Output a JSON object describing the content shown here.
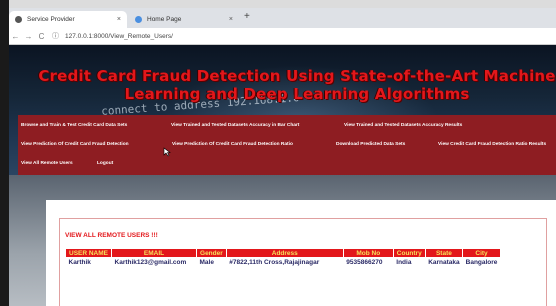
{
  "browser": {
    "tabs": [
      {
        "label": "Service Provider",
        "close": "×"
      },
      {
        "label": "Home Page",
        "close": "×"
      }
    ],
    "new_tab": "+",
    "nav": {
      "back": "←",
      "forward": "→",
      "reload": "C"
    },
    "url": "127.0.0.1:8000/View_Remote_Users/"
  },
  "hero": {
    "title": "Credit Card Fraud Detection Using State-of-the-Art Machine Learning and Deep Learning Algorithms",
    "code_text": "connect to address 192.168.1.0"
  },
  "menu": [
    "Browse and Train & Test Credit Card Data Sets",
    "View Trained and Tested Datasets Accuracy in Bar Chart",
    "View Trained and Tested Datasets Accuracy Results",
    "View Prediction Of Credit Card Fraud Detection",
    "View Prediction Of Credit Card Fraud Detection Ratio",
    "Download Predicted Data Sets",
    "View Credit Card Fraud Detection Ratio Results",
    "View All Remote Users",
    "Logout"
  ],
  "users": {
    "heading": "VIEW ALL REMOTE USERS !!!",
    "columns": [
      "USER NAME",
      "EMAIL",
      "Gender",
      "Address",
      "Mob No",
      "Country",
      "State",
      "City"
    ],
    "rows": [
      [
        "Karthik",
        "Karthik123@gmail.com",
        "Male",
        "#7822,11th Cross,Rajajinagar",
        "9535866270",
        "India",
        "Karnataka",
        "Bangalore"
      ]
    ]
  },
  "colors": {
    "accent_red": "#e3171b",
    "menu_bg": "#8e1d22",
    "header_text": "#f5e15a"
  }
}
